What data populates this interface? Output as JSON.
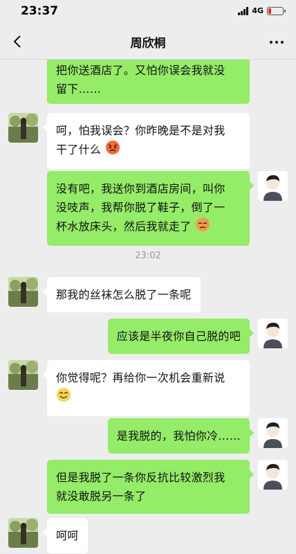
{
  "status": {
    "time": "23:37",
    "network": "4G"
  },
  "contact": {
    "name": "周欣桐"
  },
  "icons": {
    "back": "chevron-left-icon",
    "more": "ellipsis-icon",
    "angry": "angry-face-emoji",
    "sweat": "sweat-face-emoji",
    "smile": "smile-face-emoji"
  },
  "colors": {
    "my_bubble": "#95ec69",
    "their_bubble": "#ffffff",
    "background": "#ededed",
    "battery": "#e8281c"
  },
  "messages": [
    {
      "from": "me",
      "line1": "把你送酒店了。又怕你误会我就没",
      "line2": "留下……"
    },
    {
      "from": "them",
      "line1": "呵，怕我误会？你昨晚是不是对我",
      "line2": "干了什么"
    },
    {
      "from": "me",
      "line1": "没有吧，我送你到酒店房间，叫你",
      "line2": "没吱声，我帮你脱了鞋子，倒了一",
      "line3": "杯水放床头，然后我就走了"
    },
    {
      "from": "them",
      "line1": "那我的丝袜怎么脱了一条呢"
    },
    {
      "from": "me",
      "line1": "应该是半夜你自己脱的吧"
    },
    {
      "from": "them",
      "line1": "你觉得呢？再给你一次机会重新说"
    },
    {
      "from": "me",
      "line1": "是我脱的，我怕你冷……"
    },
    {
      "from": "me",
      "line1": "但是我脱了一条你反抗比较激烈我",
      "line2": "就没敢脱另一条了"
    },
    {
      "from": "them",
      "line1": "呵呵"
    }
  ],
  "timestamp": "23:02"
}
